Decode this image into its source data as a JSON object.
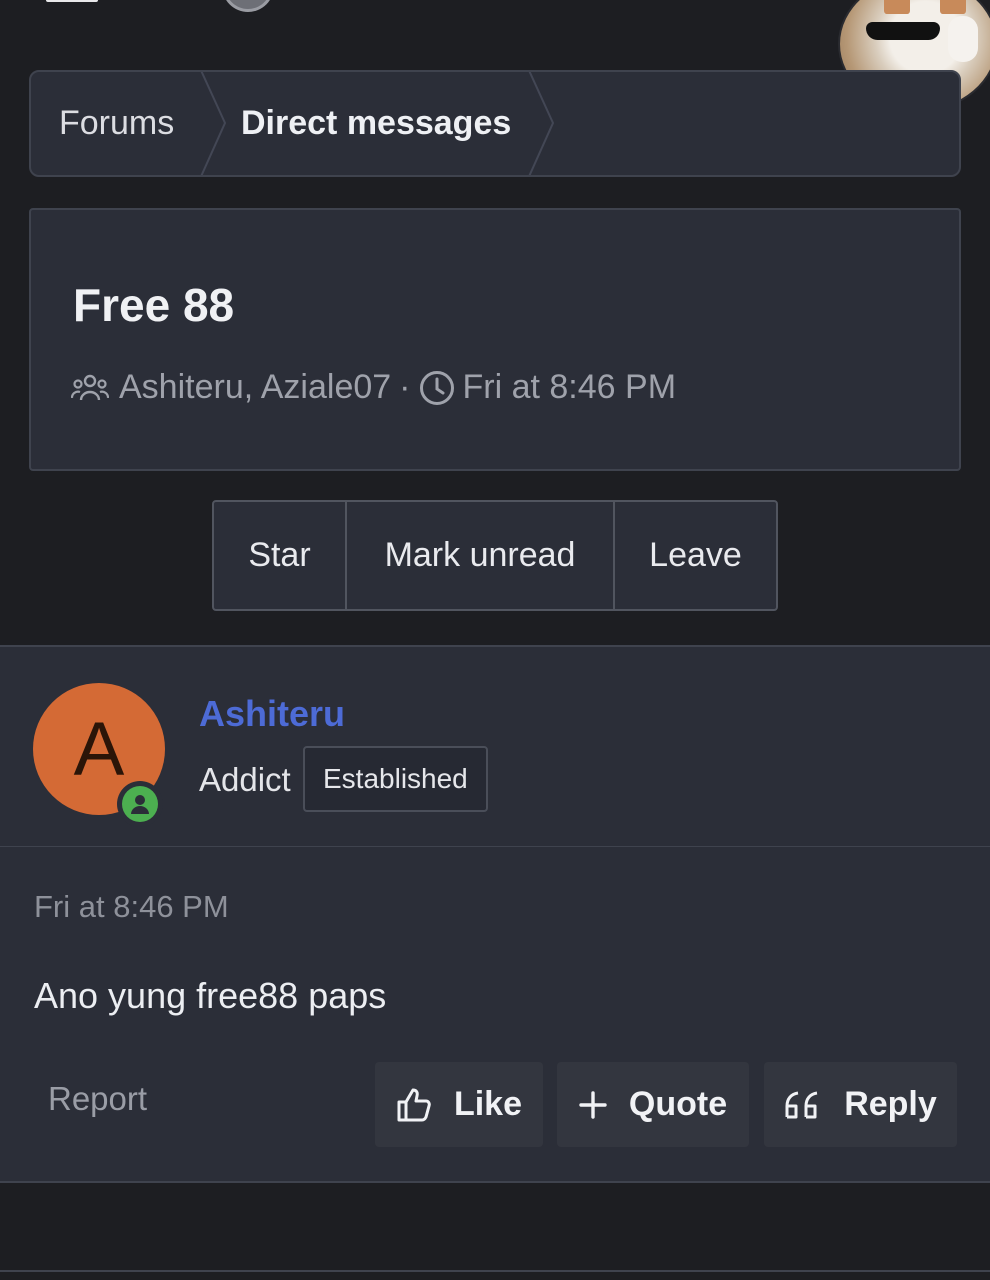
{
  "breadcrumb": {
    "items": [
      "Forums",
      "Direct messages"
    ]
  },
  "thread": {
    "title": "Free 88",
    "participants": "Ashiteru, Aziale07",
    "separator": "·",
    "time": "Fri at 8:46 PM",
    "icons": {
      "participants": "users-icon",
      "time": "clock-icon"
    }
  },
  "actions": {
    "star": "Star",
    "mark_unread": "Mark unread",
    "leave": "Leave"
  },
  "message": {
    "author": {
      "initial": "A",
      "name": "Ashiteru",
      "title": "Addict",
      "badge": "Established",
      "online": true,
      "avatar_color": "#d46a35"
    },
    "time": "Fri at 8:46 PM",
    "body": "Ano yung free88 paps",
    "report": "Report",
    "buttons": {
      "like": "Like",
      "quote": "Quote",
      "reply": "Reply"
    }
  },
  "colors": {
    "background": "#1d1e22",
    "panel": "#2b2e38",
    "username": "#4d6bd6",
    "online": "#4caf50"
  }
}
